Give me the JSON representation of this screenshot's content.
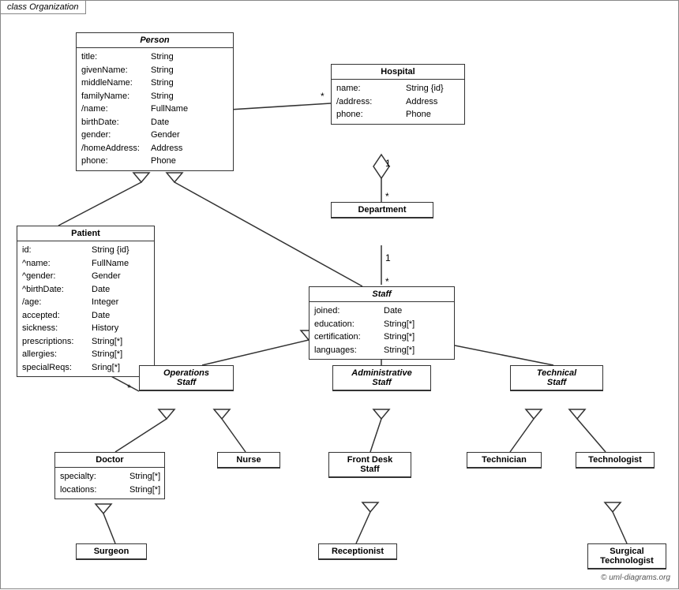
{
  "diagram": {
    "title": "class Organization",
    "copyright": "© uml-diagrams.org",
    "classes": {
      "person": {
        "title": "Person",
        "attrs": [
          {
            "name": "title:",
            "type": "String"
          },
          {
            "name": "givenName:",
            "type": "String"
          },
          {
            "name": "middleName:",
            "type": "String"
          },
          {
            "name": "familyName:",
            "type": "String"
          },
          {
            "name": "/name:",
            "type": "FullName"
          },
          {
            "name": "birthDate:",
            "type": "Date"
          },
          {
            "name": "gender:",
            "type": "Gender"
          },
          {
            "name": "/homeAddress:",
            "type": "Address"
          },
          {
            "name": "phone:",
            "type": "Phone"
          }
        ]
      },
      "hospital": {
        "title": "Hospital",
        "attrs": [
          {
            "name": "name:",
            "type": "String {id}"
          },
          {
            "name": "/address:",
            "type": "Address"
          },
          {
            "name": "phone:",
            "type": "Phone"
          }
        ]
      },
      "department": {
        "title": "Department"
      },
      "staff": {
        "title": "Staff",
        "attrs": [
          {
            "name": "joined:",
            "type": "Date"
          },
          {
            "name": "education:",
            "type": "String[*]"
          },
          {
            "name": "certification:",
            "type": "String[*]"
          },
          {
            "name": "languages:",
            "type": "String[*]"
          }
        ]
      },
      "patient": {
        "title": "Patient",
        "attrs": [
          {
            "name": "id:",
            "type": "String {id}"
          },
          {
            "name": "^name:",
            "type": "FullName"
          },
          {
            "name": "^gender:",
            "type": "Gender"
          },
          {
            "name": "^birthDate:",
            "type": "Date"
          },
          {
            "name": "/age:",
            "type": "Integer"
          },
          {
            "name": "accepted:",
            "type": "Date"
          },
          {
            "name": "sickness:",
            "type": "History"
          },
          {
            "name": "prescriptions:",
            "type": "String[*]"
          },
          {
            "name": "allergies:",
            "type": "String[*]"
          },
          {
            "name": "specialReqs:",
            "type": "Sring[*]"
          }
        ]
      },
      "operations_staff": {
        "title": "Operations Staff"
      },
      "administrative_staff": {
        "title": "Administrative Staff"
      },
      "technical_staff": {
        "title": "Technical Staff"
      },
      "doctor": {
        "title": "Doctor",
        "attrs": [
          {
            "name": "specialty:",
            "type": "String[*]"
          },
          {
            "name": "locations:",
            "type": "String[*]"
          }
        ]
      },
      "nurse": {
        "title": "Nurse"
      },
      "front_desk_staff": {
        "title": "Front Desk Staff"
      },
      "technician": {
        "title": "Technician"
      },
      "technologist": {
        "title": "Technologist"
      },
      "surgeon": {
        "title": "Surgeon"
      },
      "receptionist": {
        "title": "Receptionist"
      },
      "surgical_technologist": {
        "title": "Surgical Technologist"
      }
    }
  }
}
